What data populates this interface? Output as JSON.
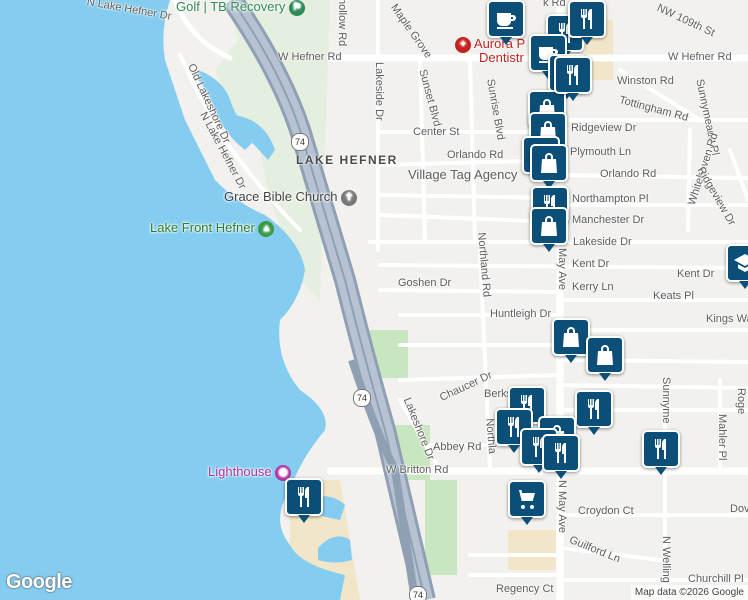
{
  "map": {
    "colors": {
      "water": "#84cdf0",
      "land": "#f2f1ee",
      "park": "#c8e6c0",
      "sand": "#f2e6c9",
      "road": "#ffffff",
      "highway": "#9ca9ba",
      "pin": "#0b4f79"
    },
    "area_label": "LAKE HEFNER",
    "street_labels": [
      "N Lake Hefner Dr",
      "Old Lakeshore Dr",
      "N Lake Hefner Dr",
      "W Hefner Rd",
      "W Hefner Rd",
      "hollow Rd",
      "Maple Grove",
      "Lakeside Dr",
      "Sunset Blvd",
      "Sunrise Blvd",
      "Center St",
      "Orlando Rd",
      "Plymouth Ln",
      "Ridgeview Dr",
      "Winston Rd",
      "Tottingham Rd",
      "Sunnymeade Pl",
      "NW 109th St",
      "Orlando Rd",
      "Whitehaven Rd",
      "Ridgeview Dr",
      "Northampton Pl",
      "Manchester Dr",
      "Lakeside Dr",
      "Kent Dr",
      "Kent Dr",
      "Kerry Ln",
      "Keats Pl",
      "Kings Wa",
      "Goshen Dr",
      "Northland Rd",
      "Huntleigh Dr",
      "N May Ave",
      "Chaucer Dr",
      "Berksh",
      "Lakeshore Dr",
      "Abbey Rd",
      "Northla",
      "W Britton Rd",
      "N May Ave",
      "Sunnyme",
      "Mahler Pl",
      "Croydon Ct",
      "Guilford Ln",
      "N Welling",
      "Dov",
      "Churchill Pl",
      "Regency Ct",
      "Roge",
      "k Rd"
    ],
    "pois": [
      {
        "name": "Golf | TB Recovery",
        "color": "#2e8b57",
        "icon": "golf-flag-icon"
      },
      {
        "name": "Aurora P",
        "color": "#c5221f",
        "icon": "hospital-cross-icon"
      },
      {
        "name": "Dentistr",
        "color": "#c5221f",
        "icon": "dentist-icon"
      },
      {
        "name": "Village Tag Agency",
        "color": "#5d5d5d",
        "icon": "none"
      },
      {
        "name": "Grace Bible Church",
        "color": "#444444",
        "icon": "church-cross-icon"
      },
      {
        "name": "Lake Front Hefner",
        "color": "#2e7d32",
        "icon": "tree-icon"
      },
      {
        "name": "Lighthouse",
        "color": "#b0339e",
        "icon": "camera-icon"
      }
    ],
    "shields": [
      "74",
      "74",
      "74"
    ],
    "markers": [
      "cafe-icon",
      "restaurant-icon",
      "restaurant-icon",
      "coffee-icon",
      "restaurant-icon",
      "shopping-bag-icon",
      "shopping-bag-icon",
      "shopping-bag-icon",
      "shopping-bag-icon",
      "restaurant-icon",
      "shopping-bag-icon",
      "school-icon",
      "restaurant-icon",
      "shopping-bag-icon",
      "shopping-bag-icon",
      "restaurant-icon",
      "restaurant-icon",
      "shopping-bag-icon",
      "restaurant-icon",
      "restaurant-icon",
      "restaurant-icon",
      "restaurant-icon",
      "shopping-cart-icon",
      "restaurant-icon"
    ],
    "logo": "Google",
    "attribution": "Map data ©2026 Google"
  }
}
